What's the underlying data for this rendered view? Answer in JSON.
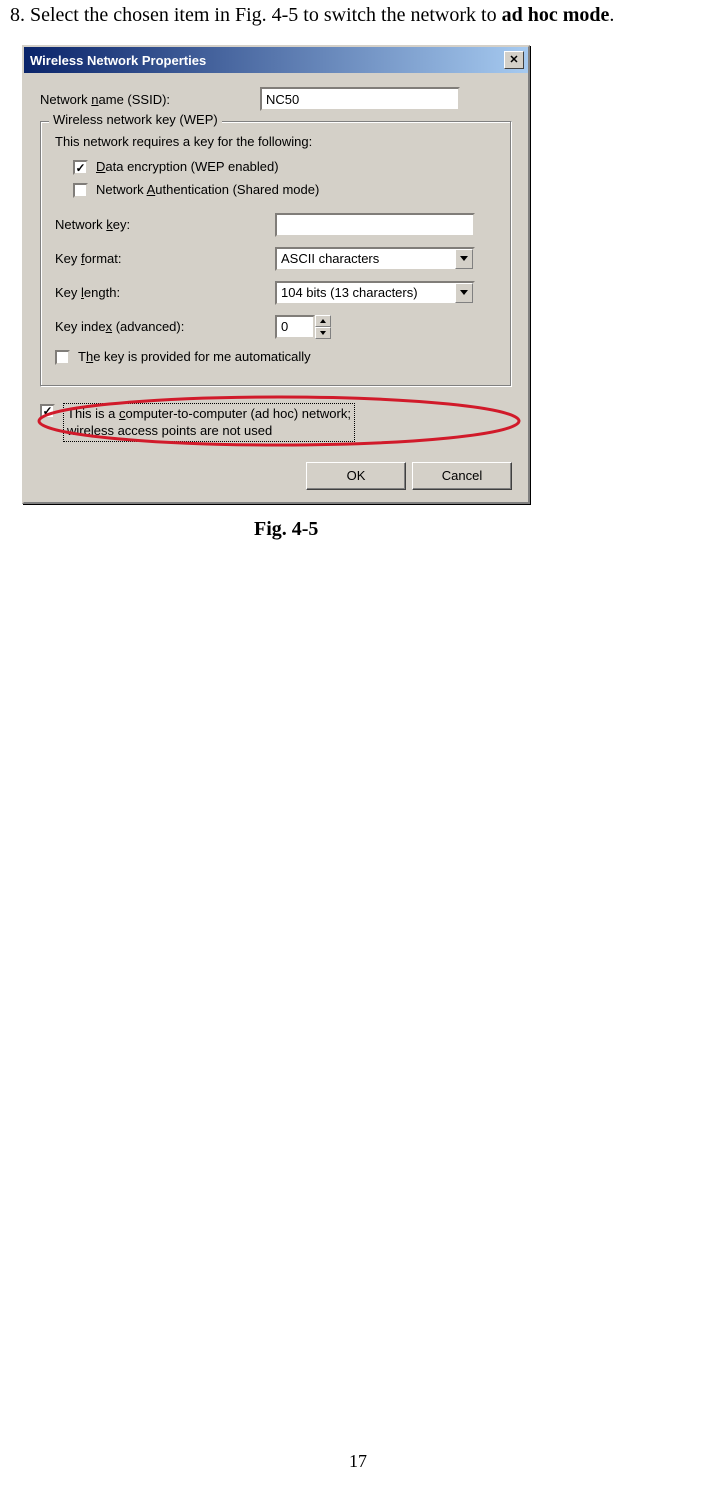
{
  "instruction": {
    "prefix": "8. Select the chosen item in Fig. 4-5 to switch the network to ",
    "bold": "ad hoc mode",
    "suffix": "."
  },
  "dialog": {
    "title": "Wireless Network Properties",
    "ssid": {
      "label_pre": "Network ",
      "label_u": "n",
      "label_post": "ame (SSID):",
      "value": "NC50"
    },
    "group": {
      "legend": "Wireless network key (WEP)",
      "note": "This network requires a key for the following:",
      "encrypt": {
        "checked": true,
        "pre": "",
        "u": "D",
        "post": "ata encryption (WEP enabled)"
      },
      "auth": {
        "checked": false,
        "pre": "Network ",
        "u": "A",
        "post": "uthentication (Shared mode)"
      },
      "netkey": {
        "label_pre": "Network ",
        "label_u": "k",
        "label_post": "ey:",
        "value": ""
      },
      "keyformat": {
        "label_pre": "Key ",
        "label_u": "f",
        "label_post": "ormat:",
        "value": "ASCII characters"
      },
      "keylength": {
        "label_pre": "Key ",
        "label_u": "l",
        "label_post": "ength:",
        "value": "104 bits (13 characters)"
      },
      "keyindex": {
        "label_pre": "Key inde",
        "label_u": "x",
        "label_post": " (advanced):",
        "value": "0"
      },
      "auto": {
        "checked": false,
        "pre": "T",
        "u": "h",
        "post": "e key is provided for me automatically"
      }
    },
    "adhoc": {
      "checked": true,
      "text_pre": "This is a ",
      "text_u": "c",
      "text_post1": "omputer-to-computer (ad hoc) network;",
      "text_line2": "wireless access points are not used"
    },
    "buttons": {
      "ok": "OK",
      "cancel": "Cancel"
    }
  },
  "figure_caption": "Fig. 4-5",
  "page_number": "17",
  "highlight_color": "#d11a2a"
}
